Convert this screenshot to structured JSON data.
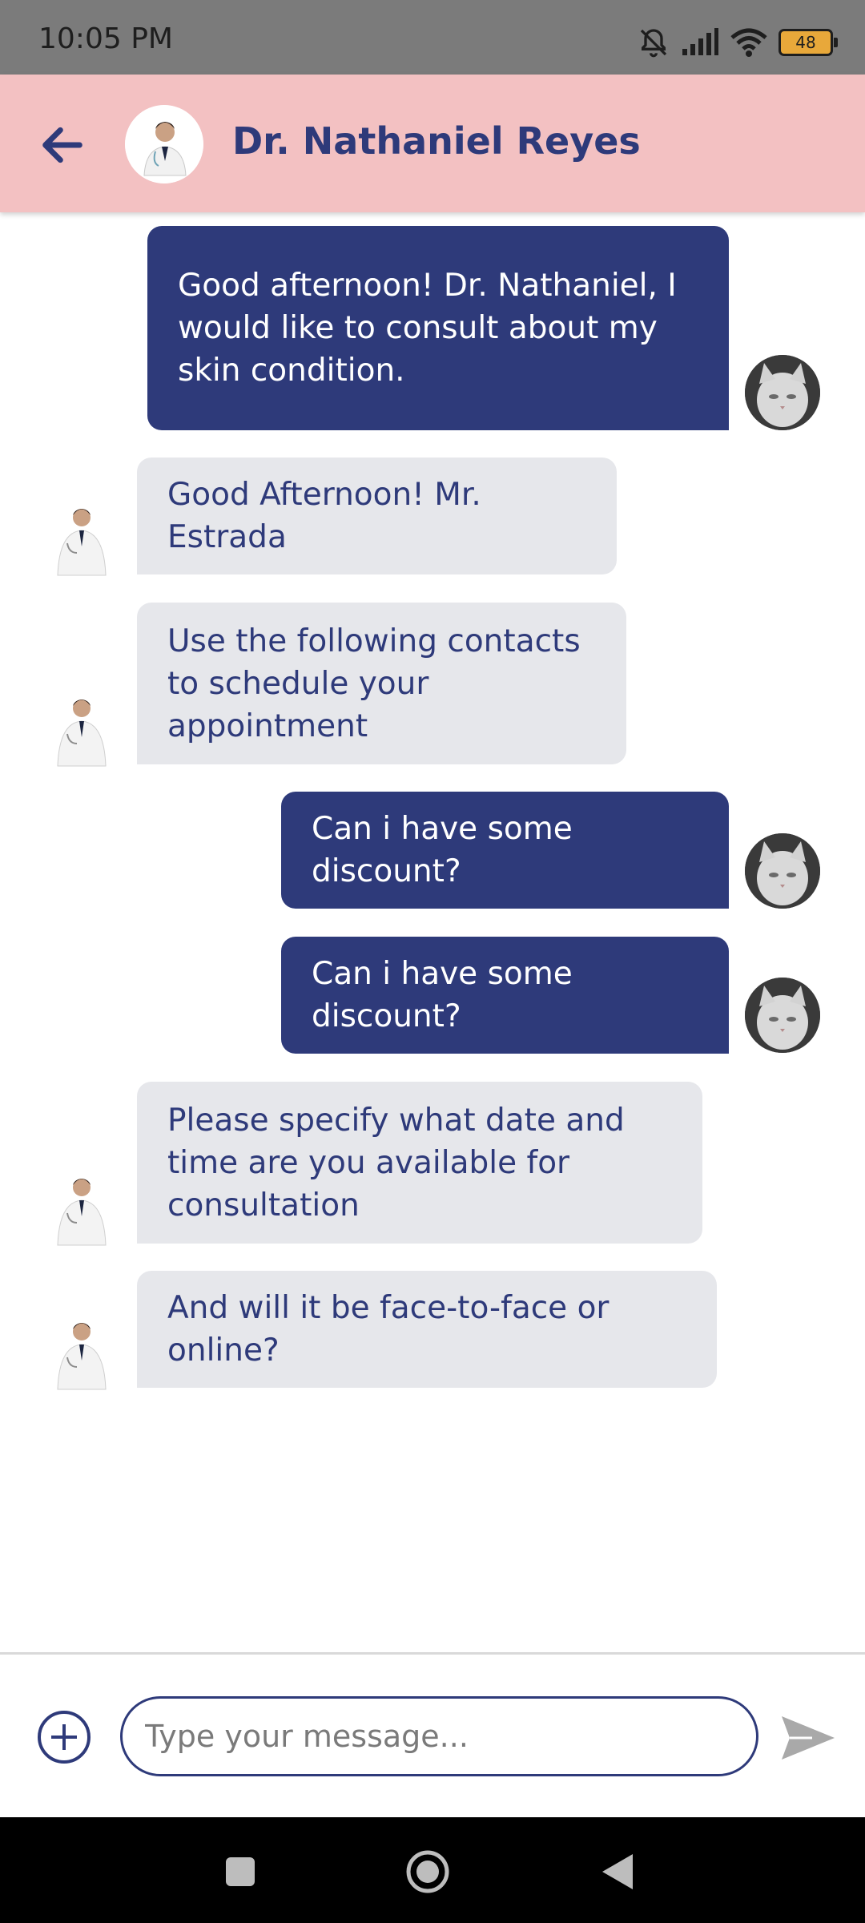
{
  "status_bar": {
    "time": "10:05 PM",
    "battery": "48",
    "icons": [
      "bell-off-icon",
      "signal-icon",
      "wifi-icon",
      "battery-icon"
    ]
  },
  "header": {
    "contact_name": "Dr. Nathaniel Reyes",
    "icons": [
      "back-arrow-icon",
      "doctor-avatar"
    ]
  },
  "messages": [
    {
      "sender": "user",
      "text": "Good afternoon! Dr. Nathaniel, I would like to consult about my skin condition."
    },
    {
      "sender": "doctor",
      "text": "Good Afternoon! Mr. Estrada"
    },
    {
      "sender": "doctor",
      "text": "Use the following contacts to schedule your appointment"
    },
    {
      "sender": "user",
      "text": "Can i have some discount?"
    },
    {
      "sender": "user",
      "text": "Can i have some discount?"
    },
    {
      "sender": "doctor",
      "text": "Please specify what date and time are you available for consultation"
    },
    {
      "sender": "doctor",
      "text": "And will it be face-to-face or online?"
    }
  ],
  "composer": {
    "placeholder": "Type your message...",
    "value": "",
    "icons": [
      "add-circle-icon",
      "send-icon"
    ]
  },
  "colors": {
    "primary": "#2e3a7a",
    "header_bg": "#f3c1c2",
    "incoming_bubble": "#e6e7eb",
    "status_bar": "#7b7b7b"
  }
}
